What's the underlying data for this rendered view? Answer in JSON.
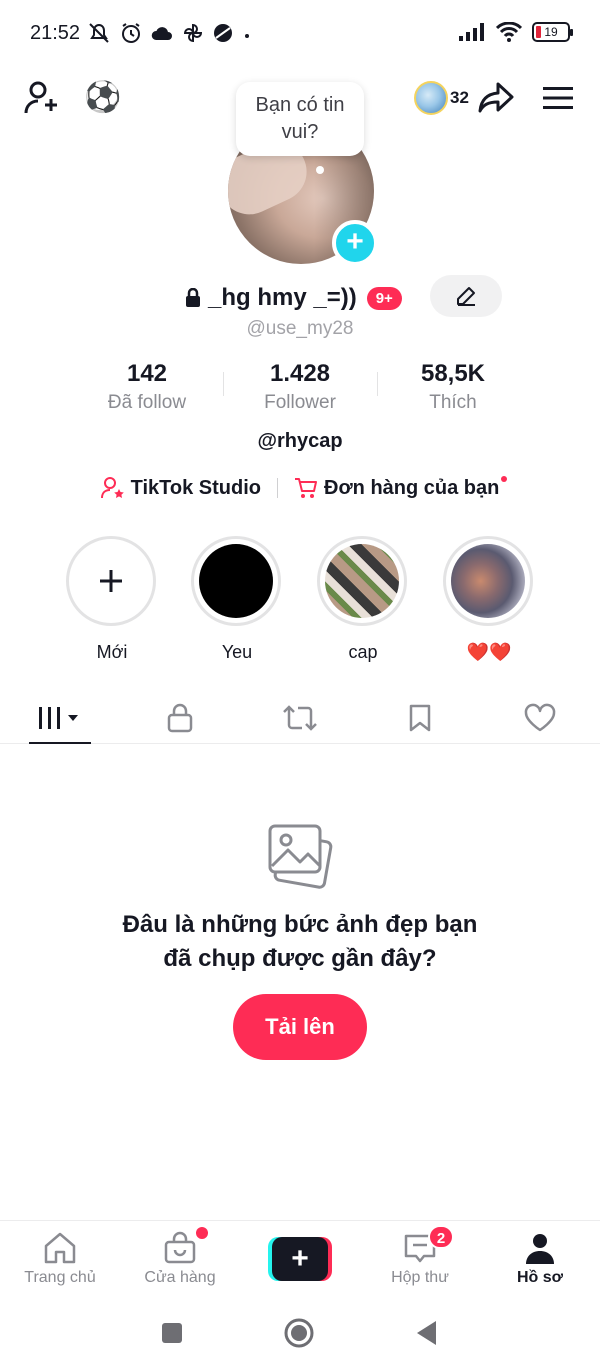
{
  "status_bar": {
    "time": "21:52",
    "battery": "19",
    "icons": [
      "mute-icon",
      "alarm-icon",
      "cloud-icon",
      "pinwheel-icon",
      "planet-icon",
      "dot-icon",
      "signal-icon",
      "wifi-icon",
      "battery-icon"
    ]
  },
  "top_bar": {
    "friends_count": "32",
    "bubble_text_line1": "Bạn có tin",
    "bubble_text_line2": "vui?"
  },
  "profile": {
    "display_name": "_hg hmy _=))",
    "notification_badge": "9+",
    "username": "@use_my28",
    "bio": "@rhycap"
  },
  "stats": [
    {
      "value": "142",
      "label": "Đã follow"
    },
    {
      "value": "1.428",
      "label": "Follower"
    },
    {
      "value": "58,5K",
      "label": "Thích"
    }
  ],
  "links": {
    "studio": "TikTok Studio",
    "orders": "Đơn hàng của bạn"
  },
  "highlights": [
    {
      "label": "Mới"
    },
    {
      "label": "Yeu"
    },
    {
      "label": "cap"
    },
    {
      "label": "❤️❤️"
    }
  ],
  "empty_state": {
    "line1": "Đâu là những bức ảnh đẹp bạn",
    "line2": "đã chụp được gần đây?",
    "button": "Tải lên"
  },
  "bottom_nav": {
    "home": "Trang chủ",
    "shop": "Cửa hàng",
    "inbox": "Hộp thư",
    "inbox_badge": "2",
    "profile": "Hồ sơ"
  },
  "colors": {
    "accent": "#fe2c55",
    "cyan": "#20d5ec",
    "text": "#161823",
    "muted": "#8a8b91"
  }
}
